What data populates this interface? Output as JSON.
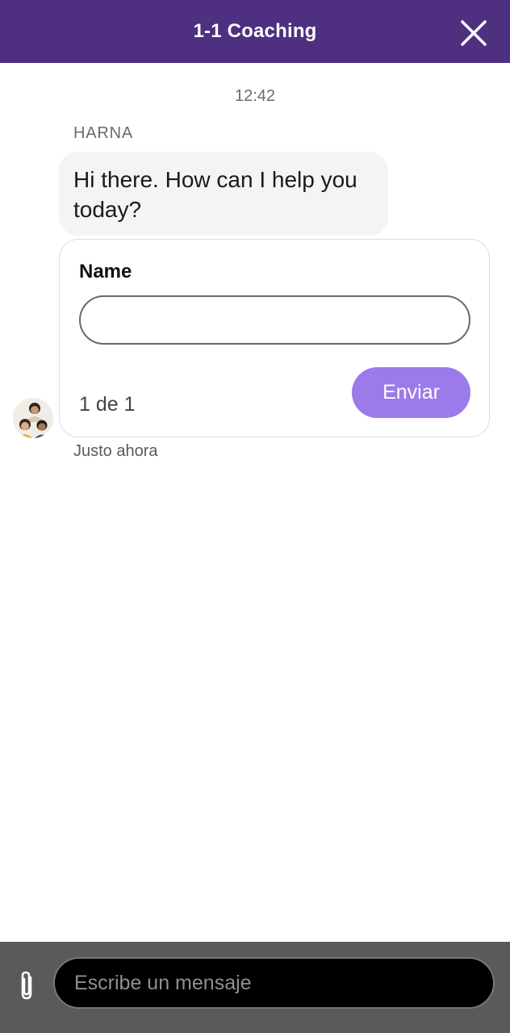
{
  "header": {
    "title": "1-1 Coaching",
    "close_icon": "close-icon"
  },
  "conversation": {
    "timestamp": "12:42",
    "sender": "HARNA",
    "message": "Hi there. How can I help you today?",
    "form": {
      "label": "Name",
      "value": "",
      "pager": "1 de 1",
      "submit_label": "Enviar"
    },
    "avatar_icon": "agents-avatar-icon",
    "sent_status": "Justo ahora"
  },
  "composer": {
    "attach_icon": "paperclip-icon",
    "placeholder": "Escribe un mensaje",
    "value": ""
  },
  "colors": {
    "header_bg": "#4f2f80",
    "send_button": "#9d7ae9",
    "bubble_bg": "#f3f4f6",
    "composer_bar": "#5a5a5a"
  }
}
